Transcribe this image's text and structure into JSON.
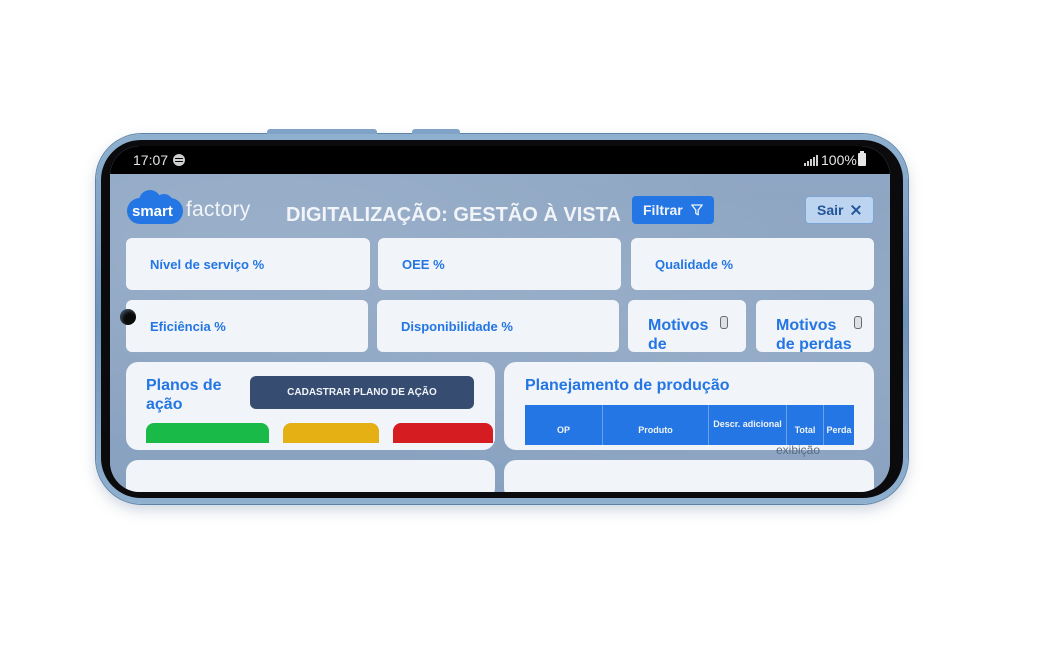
{
  "status_bar": {
    "time": "17:07",
    "battery": "100%"
  },
  "header": {
    "logo_smart": "smart",
    "logo_factory": "factory",
    "title": "DIGITALIZAÇÃO: GESTÃO À VISTA",
    "filter_label": "Filtrar",
    "logout_label": "Sair"
  },
  "kpis": [
    {
      "label": "Nível de serviço %"
    },
    {
      "label": "OEE %"
    },
    {
      "label": "Qualidade %"
    },
    {
      "label": "Eficiência %"
    },
    {
      "label": "Disponibilidade %"
    }
  ],
  "motives": [
    {
      "label": "Motivos de paradas"
    },
    {
      "label": "Motivos de perdas"
    }
  ],
  "action_plans": {
    "title": "Planos de ação",
    "button_label": "CADASTRAR PLANO DE AÇÃO",
    "status_colors": [
      "#0fbf3a",
      "#f2b400",
      "#e01010"
    ]
  },
  "production": {
    "title": "Planejamento de produção",
    "columns": [
      "OP",
      "Produto",
      "Descr. adicional",
      "Total",
      "Perda"
    ],
    "overflow_text": "exibição"
  },
  "colors": {
    "accent": "#1a73e8",
    "button_dark": "#2f4568"
  }
}
